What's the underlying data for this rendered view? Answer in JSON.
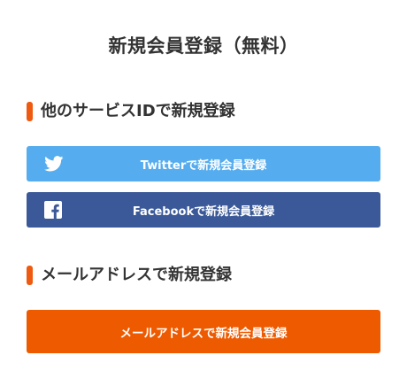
{
  "page": {
    "title": "新規会員登録（無料）"
  },
  "sections": {
    "service": {
      "heading": "他のサービスIDで新規登録",
      "accent_color": "#ee5a0f"
    },
    "email": {
      "heading": "メールアドレスで新規登録",
      "accent_color": "#ee5a0f"
    }
  },
  "buttons": {
    "twitter": {
      "label": "Twitterで新規会員登録",
      "icon": "twitter-bird-icon",
      "color": "#55acee"
    },
    "facebook": {
      "label": "Facebookで新規会員登録",
      "icon": "facebook-f-icon",
      "color": "#3b5998"
    },
    "email": {
      "label": "メールアドレスで新規会員登録",
      "color": "#ee5a00"
    }
  }
}
